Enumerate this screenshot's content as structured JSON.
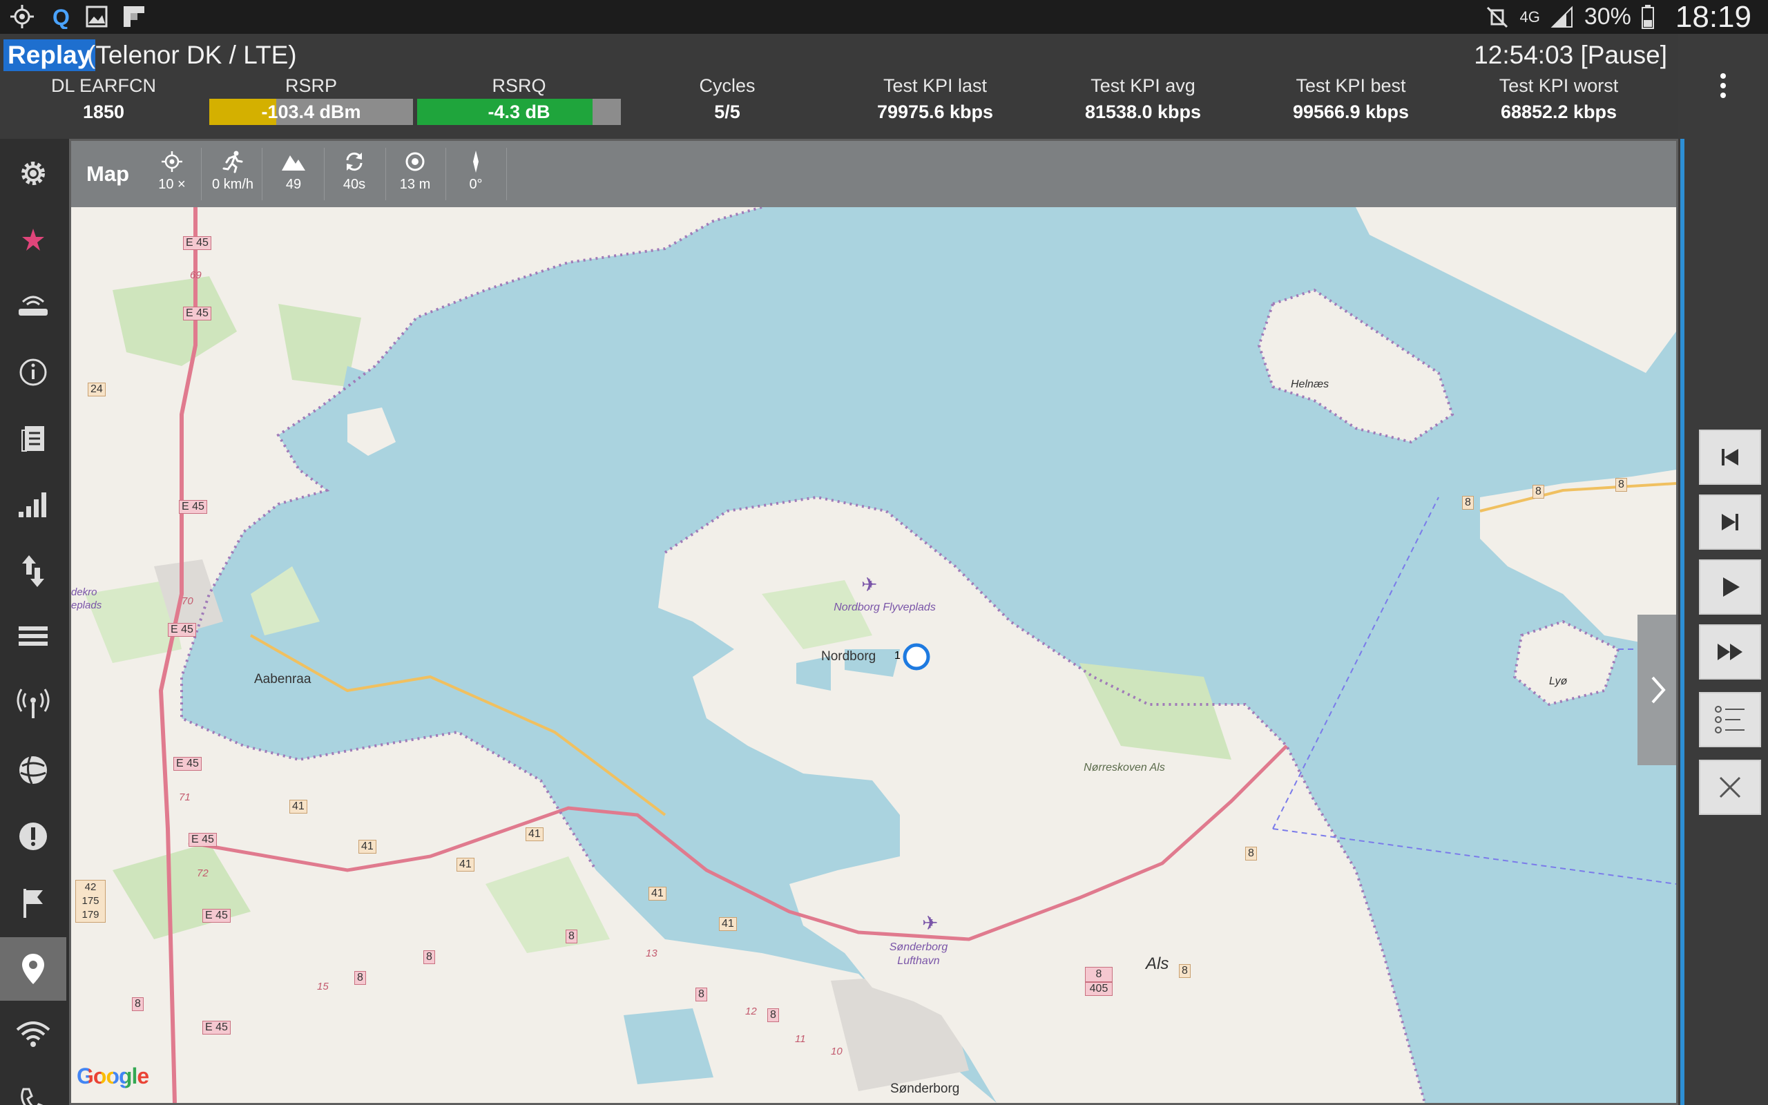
{
  "status_bar": {
    "battery": "30%",
    "time": "18:19",
    "network": "4G",
    "icons": [
      "gps-icon",
      "qualipoc-icon",
      "gallery-icon",
      "flipboard-icon",
      "mute-icon",
      "network-4g-icon",
      "signal-icon",
      "battery-icon"
    ]
  },
  "replay": {
    "badge": "Replay",
    "operator": "(Telenor DK / LTE)",
    "time": "12:54:03 [Pause]"
  },
  "kpis": {
    "dl_earfcn": {
      "label": "DL EARFCN",
      "value": "1850"
    },
    "rsrp": {
      "label": "RSRP",
      "value": "-103.4 dBm",
      "fill_fraction": 0.33,
      "color": "#d4b000"
    },
    "rsrq": {
      "label": "RSRQ",
      "value": "-4.3 dB",
      "fill_fraction": 0.86,
      "color": "#1fa53c"
    },
    "cycles": {
      "label": "Cycles",
      "value": "5/5"
    },
    "test_kpi_last": {
      "label": "Test KPI last",
      "value": "79975.6 kbps"
    },
    "test_kpi_avg": {
      "label": "Test KPI avg",
      "value": "81538.0 kbps"
    },
    "test_kpi_best": {
      "label": "Test KPI best",
      "value": "99566.9 kbps"
    },
    "test_kpi_worst": {
      "label": "Test KPI worst",
      "value": "68852.2 kbps"
    }
  },
  "sidebar": {
    "items": [
      "settings-icon",
      "star-icon",
      "router-icon",
      "info-icon",
      "document-icon",
      "bar-chart-icon",
      "transfer-icon",
      "list-icon",
      "antenna-icon",
      "globe-icon",
      "alert-icon",
      "flag-icon",
      "map-marker-icon",
      "wifi-icon",
      "phone-icon"
    ],
    "active": "map-marker-icon"
  },
  "map_toolbar": {
    "title": "Map",
    "zoom": "10 ×",
    "speed": "0 km/h",
    "altitude": "49",
    "refresh": "40s",
    "accuracy": "13 m",
    "heading": "0°"
  },
  "map": {
    "labels": {
      "nordborg": "Nordborg",
      "flyveplads": "Nordborg Flyveplads",
      "aabenraa": "Aabenraa",
      "als": "Als",
      "helnaes": "Helnæs",
      "lyo": "Lyø",
      "norreskoven": "Nørreskoven Als",
      "sonderborg": "Sønderborg",
      "lufthavn": "Sønderborg Lufthavn",
      "dekro": "dekro eplads"
    },
    "roads": [
      "E 45",
      "69",
      "70",
      "71",
      "72",
      "24",
      "41",
      "42 175 179",
      "8",
      "405",
      "13",
      "12",
      "11",
      "10",
      "15"
    ],
    "marker": "1",
    "attribution": "Google"
  },
  "controls": [
    "skip-previous-icon",
    "skip-next-icon",
    "play-icon",
    "fast-forward-icon",
    "options-list-icon",
    "close-icon"
  ]
}
